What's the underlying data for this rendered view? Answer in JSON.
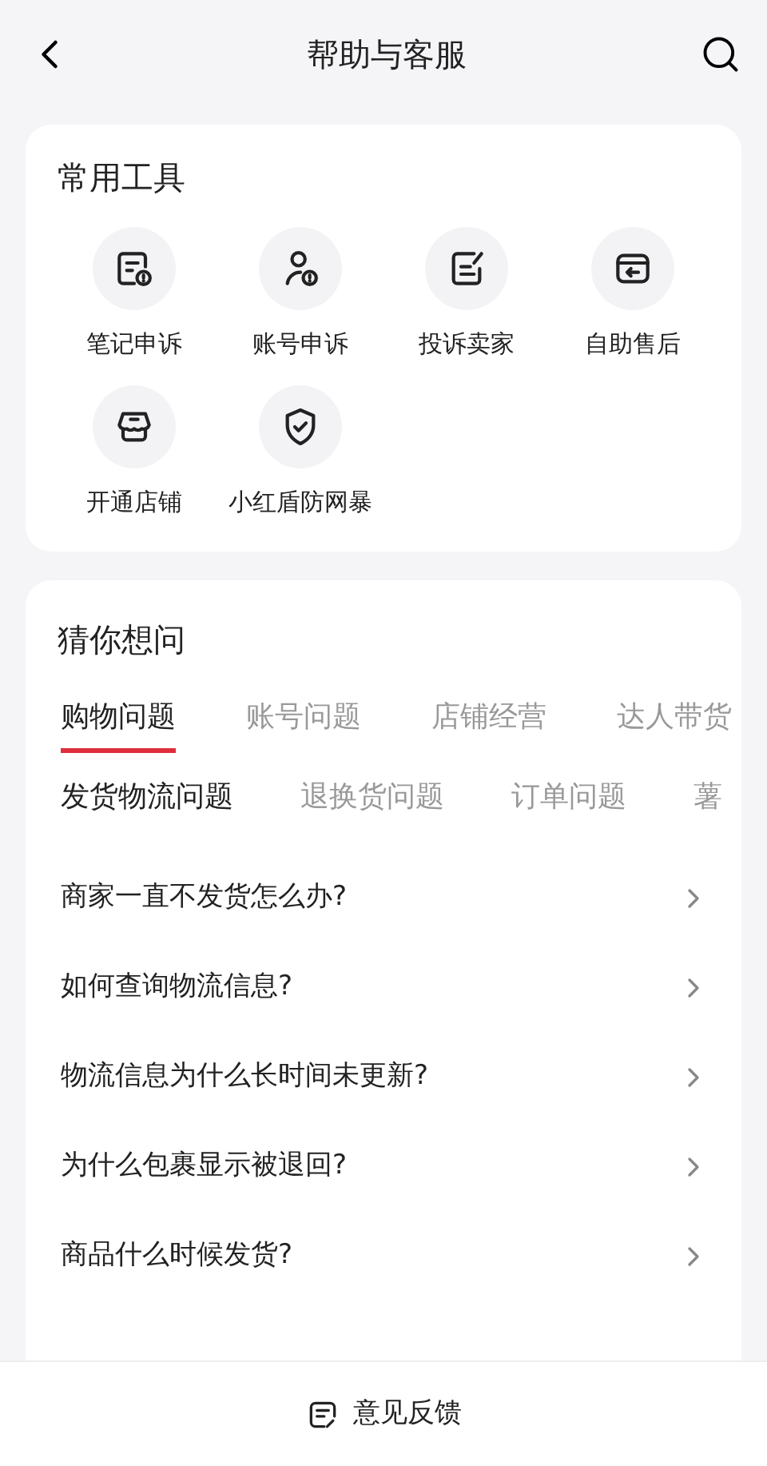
{
  "header": {
    "title": "帮助与客服"
  },
  "tools": {
    "title": "常用工具",
    "items": [
      {
        "kind": "note",
        "label": "笔记申诉"
      },
      {
        "kind": "account",
        "label": "账号申诉"
      },
      {
        "kind": "complain",
        "label": "投诉卖家"
      },
      {
        "kind": "aftersale",
        "label": "自助售后"
      },
      {
        "kind": "shop",
        "label": "开通店铺"
      },
      {
        "kind": "shield",
        "label": "小红盾防网暴"
      }
    ]
  },
  "faq": {
    "title": "猜你想问",
    "tabs": [
      {
        "label": "购物问题",
        "selected": true
      },
      {
        "label": "账号问题",
        "selected": false
      },
      {
        "label": "店铺经营",
        "selected": false
      },
      {
        "label": "达人带货",
        "selected": false
      }
    ],
    "subtabs": [
      {
        "label": "发货物流问题",
        "selected": true
      },
      {
        "label": "退换货问题",
        "selected": false
      },
      {
        "label": "订单问题",
        "selected": false
      },
      {
        "label": "薯",
        "selected": false
      }
    ],
    "questions": [
      "商家一直不发货怎么办?",
      "如何查询物流信息?",
      "物流信息为什么长时间未更新?",
      "为什么包裹显示被退回?",
      "商品什么时候发货?"
    ]
  },
  "footer": {
    "button": "意见反馈"
  }
}
